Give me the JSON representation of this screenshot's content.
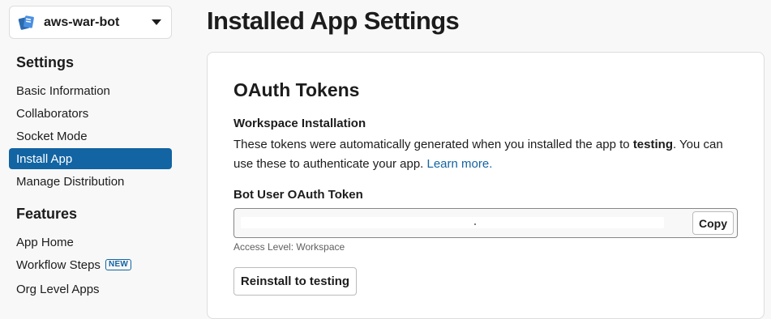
{
  "app_switcher": {
    "app_name": "aws-war-bot",
    "icon": "app-logo-icon"
  },
  "sidebar": {
    "settings_heading": "Settings",
    "settings_items": [
      {
        "label": "Basic Information",
        "active": false
      },
      {
        "label": "Collaborators",
        "active": false
      },
      {
        "label": "Socket Mode",
        "active": false
      },
      {
        "label": "Install App",
        "active": true
      },
      {
        "label": "Manage Distribution",
        "active": false
      }
    ],
    "features_heading": "Features",
    "features_items": [
      {
        "label": "App Home"
      },
      {
        "label": "Workflow Steps",
        "badge": "NEW"
      },
      {
        "label": "Org Level Apps"
      }
    ]
  },
  "page": {
    "title": "Installed App Settings",
    "section_title": "OAuth Tokens",
    "subsection_title": "Workspace Installation",
    "description_part1": "These tokens were automatically generated when you installed the app to ",
    "description_bold": "testing",
    "description_part2": ". You can use these to authenticate your app. ",
    "learn_more": "Learn more.",
    "token_label": "Bot User OAuth Token",
    "copy_label": "Copy",
    "access_level": "Access Level: Workspace",
    "reinstall_label": "Reinstall to testing"
  },
  "colors": {
    "accent": "#1264a3",
    "background": "#f8f8f8"
  }
}
